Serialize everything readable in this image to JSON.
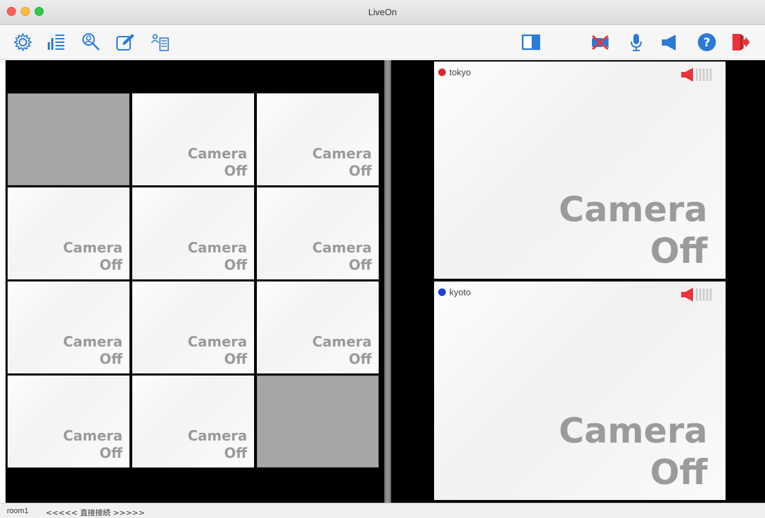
{
  "window": {
    "title": "LiveOn"
  },
  "toolbar": {
    "left_icons": [
      "gear-icon",
      "level-meter-icon",
      "search-user-icon",
      "edit-icon",
      "user-list-icon"
    ],
    "right_icons": [
      "layout-toggle-icon",
      "camera-off-icon",
      "microphone-icon",
      "speaker-icon",
      "help-icon",
      "exit-icon"
    ],
    "accent": "#2b7bd6",
    "danger": "#e8343a"
  },
  "grid": {
    "tiles": [
      {
        "state": "empty"
      },
      {
        "state": "camera-off",
        "line1": "Camera",
        "line2": "Off"
      },
      {
        "state": "camera-off",
        "line1": "Camera",
        "line2": "Off"
      },
      {
        "state": "camera-off",
        "line1": "Camera",
        "line2": "Off"
      },
      {
        "state": "camera-off",
        "line1": "Camera",
        "line2": "Off"
      },
      {
        "state": "camera-off",
        "line1": "Camera",
        "line2": "Off"
      },
      {
        "state": "camera-off",
        "line1": "Camera",
        "line2": "Off"
      },
      {
        "state": "camera-off",
        "line1": "Camera",
        "line2": "Off"
      },
      {
        "state": "camera-off",
        "line1": "Camera",
        "line2": "Off"
      },
      {
        "state": "camera-off",
        "line1": "Camera",
        "line2": "Off"
      },
      {
        "state": "camera-off",
        "line1": "Camera",
        "line2": "Off"
      },
      {
        "state": "empty"
      }
    ]
  },
  "videos": [
    {
      "name": "tokyo",
      "dot_color": "#e0262d",
      "line1": "Camera",
      "line2": "Off"
    },
    {
      "name": "kyoto",
      "dot_color": "#1f3fd6",
      "line1": "Camera",
      "line2": "Off"
    }
  ],
  "status": {
    "room": "room1",
    "connection": "<<<<< 直接接続 >>>>>"
  }
}
